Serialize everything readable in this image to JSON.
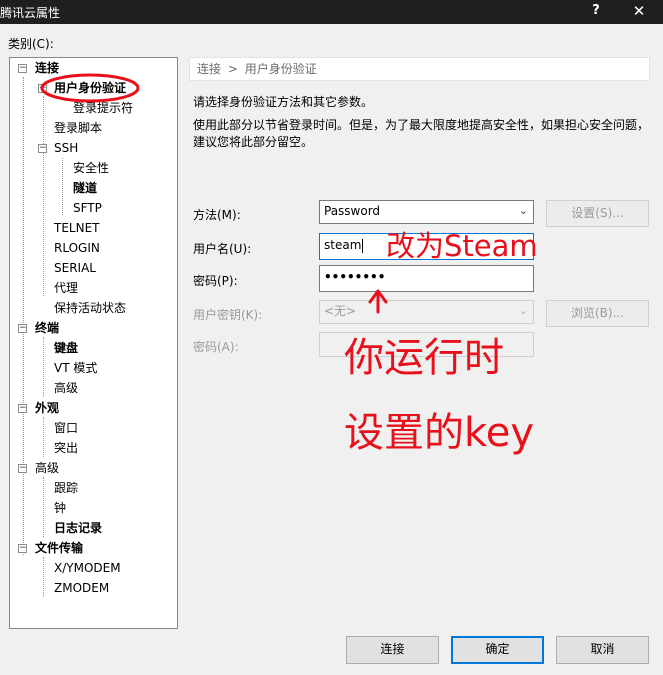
{
  "window": {
    "title": "腾讯云属性",
    "help_glyph": "?",
    "close_glyph": "✕"
  },
  "category_label": "类别(C):",
  "tree": {
    "items": [
      {
        "label": "连接",
        "bold": true,
        "expander": "−"
      },
      {
        "label": "用户身份验证",
        "bold": true,
        "expander": "−"
      },
      {
        "label": "登录提示符",
        "bold": false
      },
      {
        "label": "登录脚本",
        "bold": false
      },
      {
        "label": "SSH",
        "bold": false,
        "expander": "−"
      },
      {
        "label": "安全性",
        "bold": false
      },
      {
        "label": "隧道",
        "bold": true
      },
      {
        "label": "SFTP",
        "bold": false
      },
      {
        "label": "TELNET",
        "bold": false
      },
      {
        "label": "RLOGIN",
        "bold": false
      },
      {
        "label": "SERIAL",
        "bold": false
      },
      {
        "label": "代理",
        "bold": false
      },
      {
        "label": "保持活动状态",
        "bold": false
      },
      {
        "label": "终端",
        "bold": true,
        "expander": "−"
      },
      {
        "label": "键盘",
        "bold": true
      },
      {
        "label": "VT 模式",
        "bold": false
      },
      {
        "label": "高级",
        "bold": false
      },
      {
        "label": "外观",
        "bold": true,
        "expander": "−"
      },
      {
        "label": "窗口",
        "bold": false
      },
      {
        "label": "突出",
        "bold": false
      },
      {
        "label": "高级",
        "bold": false,
        "expander": "−"
      },
      {
        "label": "跟踪",
        "bold": false
      },
      {
        "label": "钟",
        "bold": false
      },
      {
        "label": "日志记录",
        "bold": true
      },
      {
        "label": "文件传输",
        "bold": true,
        "expander": "−"
      },
      {
        "label": "X/YMODEM",
        "bold": false
      },
      {
        "label": "ZMODEM",
        "bold": false
      }
    ]
  },
  "breadcrumb": {
    "parent": "连接",
    "separator": ">",
    "current": "用户身份验证"
  },
  "description": {
    "line1": "请选择身份验证方法和其它参数。",
    "line2": "使用此部分以节省登录时间。但是，为了最大限度地提高安全性，如果担心安全问题，",
    "line3": "建议您将此部分留空。"
  },
  "form": {
    "method_label": "方法(M):",
    "method_value": "Password",
    "setup_button": "设置(S)...",
    "username_label": "用户名(U):",
    "username_value": "steam",
    "password_label": "密码(P):",
    "password_value": "••••••••",
    "userkey_label": "用户密钥(K):",
    "userkey_value": "<无>",
    "browse_button": "浏览(B)...",
    "passphrase_label": "密码(A):"
  },
  "buttons": {
    "connect": "连接",
    "ok": "确定",
    "cancel": "取消"
  },
  "annotations": {
    "color": "#e8101a",
    "note1": "改为Steam",
    "note2_line1": "你运行时",
    "note2_line2": "设置的key"
  },
  "colors": {
    "titlebar": "#1f1f1f",
    "dialog_bg": "#f0f0f0",
    "focus": "#0078d7"
  }
}
